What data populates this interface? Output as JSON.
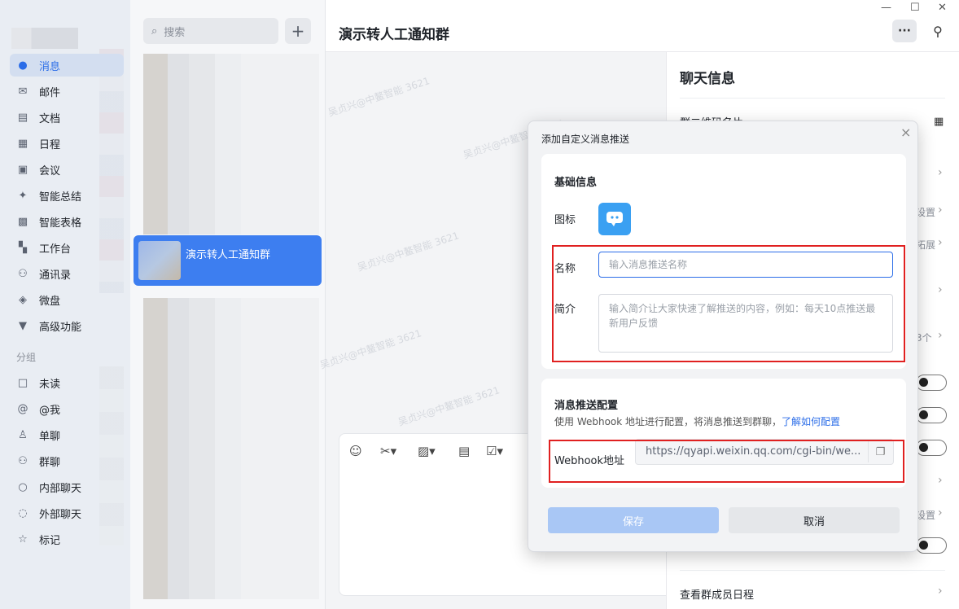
{
  "nav": {
    "items": [
      {
        "label": "消息",
        "icon": "chat-bubble-icon"
      },
      {
        "label": "邮件",
        "icon": "mail-icon"
      },
      {
        "label": "文档",
        "icon": "document-icon"
      },
      {
        "label": "日程",
        "icon": "calendar-icon"
      },
      {
        "label": "会议",
        "icon": "meeting-icon"
      },
      {
        "label": "智能总结",
        "icon": "sparkle-icon"
      },
      {
        "label": "智能表格",
        "icon": "table-icon"
      },
      {
        "label": "工作台",
        "icon": "grid-icon"
      },
      {
        "label": "通讯录",
        "icon": "contacts-icon"
      },
      {
        "label": "微盘",
        "icon": "drive-icon"
      },
      {
        "label": "高级功能",
        "icon": "advanced-icon"
      }
    ],
    "section_label": "分组",
    "groups": [
      {
        "label": "未读",
        "icon": "unread-icon"
      },
      {
        "label": "@我",
        "icon": "at-icon"
      },
      {
        "label": "单聊",
        "icon": "person-icon"
      },
      {
        "label": "群聊",
        "icon": "group-icon"
      },
      {
        "label": "内部聊天",
        "icon": "internal-chat-icon"
      },
      {
        "label": "外部聊天",
        "icon": "external-chat-icon"
      },
      {
        "label": "标记",
        "icon": "star-icon"
      }
    ]
  },
  "list": {
    "search_placeholder": "搜索",
    "add_label": "+",
    "active_conversation": "演示转人工通知群"
  },
  "chat": {
    "title": "演示转人工通知群",
    "more_label": "···",
    "watermark": "吴贞兴@中鳌智能 3621"
  },
  "info": {
    "title": "聊天信息",
    "qr_label": "群二维码名片",
    "snip_setting": "设置",
    "snip_expand": "拓展",
    "snip_count": "3个",
    "bottom_label": "查看群成员日程"
  },
  "modal": {
    "title": "添加自定义消息推送",
    "basic": {
      "heading": "基础信息",
      "icon_label": "图标",
      "name_label": "名称",
      "name_placeholder": "输入消息推送名称",
      "desc_label": "简介",
      "desc_placeholder": "输入简介让大家快速了解推送的内容，例如：每天10点推送最新用户反馈"
    },
    "config": {
      "heading": "消息推送配置",
      "description": "使用 Webhook 地址进行配置，将消息推送到群聊，",
      "learn_link": "了解如何配置",
      "webhook_label": "Webhook地址",
      "webhook_value": "https://qyapi.weixin.qq.com/cgi-bin/we..."
    },
    "save_label": "保存",
    "cancel_label": "取消"
  }
}
